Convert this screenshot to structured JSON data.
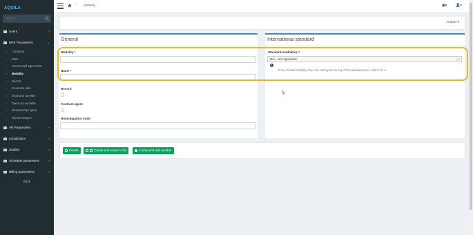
{
  "app": {
    "logo_text": "AQUILA"
  },
  "sidebar": {
    "search_placeholder": "Search",
    "items": [
      {
        "label": "Users"
      },
      {
        "label": "HRK Parameters"
      },
      {
        "label": "VR Parameters"
      },
      {
        "label": "Localization"
      },
      {
        "label": "Studies"
      },
      {
        "label": "Schedule parameters"
      },
      {
        "label": "Billing parameters"
      }
    ],
    "subitems": [
      {
        "label": "Company"
      },
      {
        "label": "Sites"
      },
      {
        "label": "Commercial agreement"
      },
      {
        "label": "Modality"
      },
      {
        "label": "Rooms"
      },
      {
        "label": "Insurance plan"
      },
      {
        "label": "Insurance provider"
      },
      {
        "label": "Taxes accountable"
      },
      {
        "label": "Membership regime"
      },
      {
        "label": "Report margins"
      }
    ],
    "back_label": "Back"
  },
  "header": {
    "breadcrumb_current": "Modality",
    "actions_label": "Actions"
  },
  "general": {
    "title": "General",
    "modality_label": "Modality *",
    "modality_value": "",
    "name_label": "Name *",
    "name_value": "",
    "record_label": "Record",
    "contrast_label": "Contrast agent",
    "homologation_label": "Homologation Code",
    "homologation_value": ""
  },
  "international": {
    "title": "International standard",
    "standard_label": "Standard modalities *",
    "standard_selected": "N/A - Not Applicable",
    "help_text": "If the created modality does not correspond to any of the standard ones, select N / A."
  },
  "buttons": {
    "create": "Create",
    "create_return": "Create and return to list",
    "create_add": "Create and add another"
  },
  "colors": {
    "sidebar": "#222d32",
    "accent": "#3c8dbc",
    "success": "#00a65a",
    "highlight": "#f2b31d"
  }
}
